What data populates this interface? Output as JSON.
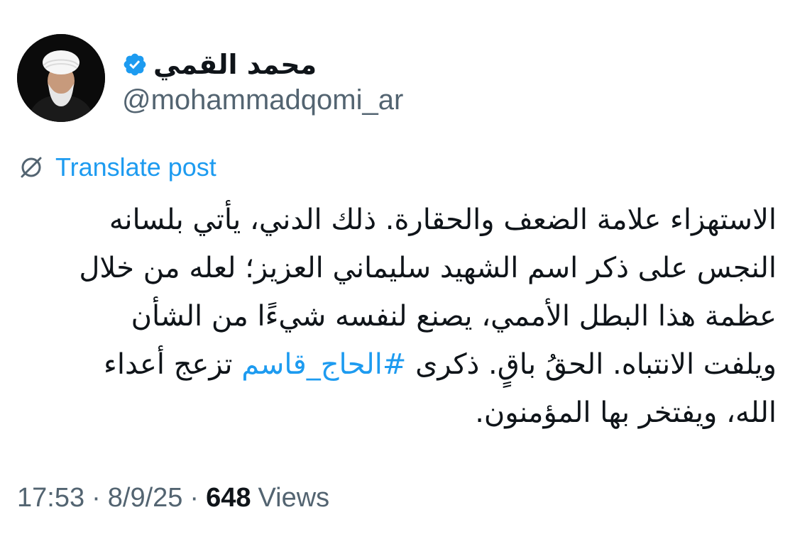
{
  "author": {
    "display_name": "محمد القمي",
    "handle": "@mohammadqomi_ar",
    "avatar_icon": "avatar-photo",
    "verified_icon": "verified-badge-icon",
    "verified_color": "#1d9bf0"
  },
  "translate": {
    "icon": "globe-slash-icon",
    "label": "Translate post",
    "color": "#1d9bf0"
  },
  "tweet": {
    "lines": [
      "الاستهزاء علامة الضعف والحقارة. ذلك الدني، يأتي بلسانه",
      "النجس على ذكر اسم الشهيد سليماني العزيز؛ لعله من خلال",
      "عظمة هذا البطل الأممي، يصنع لنفسه شيءًا من الشأن",
      "ويلفت الانتباه. الحقُ باقٍ. ذكرى",
      "الله، ويفتخر بها المؤمنون."
    ],
    "hashtag": "#الحاج_قاسم",
    "line4_after": "تزعج أعداء",
    "hashtag_color": "#1d9bf0"
  },
  "meta": {
    "time": "17:53",
    "separator": "·",
    "date": "8/9/25",
    "views_count": "648",
    "views_label": "Views"
  }
}
